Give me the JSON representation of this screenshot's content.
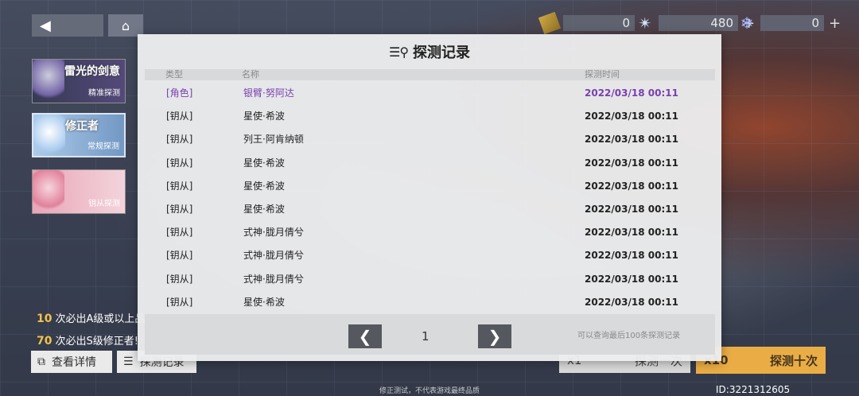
{
  "top_bar": {
    "currencies": [
      {
        "icon": "ticket-icon",
        "value": "0"
      },
      {
        "icon": "star-crystal-icon",
        "value": "480"
      },
      {
        "icon": "snowflake-icon",
        "value": "0"
      }
    ],
    "plus_symbol": "+"
  },
  "banners": [
    {
      "title": "雷光的剑意",
      "subtitle": "精准探测"
    },
    {
      "title": "修正者",
      "subtitle": "常规探测"
    },
    {
      "title": "",
      "subtitle": "钥从探测"
    }
  ],
  "notes": [
    {
      "num": "10",
      "text": "次必出A级或以上品"
    },
    {
      "num": "70",
      "text": "次必出S级修正者!"
    }
  ],
  "bottom_buttons": {
    "details": "查看详情",
    "records": "探测记录"
  },
  "draw": {
    "one_count": "x1",
    "one_label": "探测一次",
    "ten_count": "x10",
    "ten_label": "探测十次"
  },
  "footer_note": "修正测试，不代表游戏最终品质",
  "uid": "ID:3221312605",
  "modal": {
    "title": "探测记录",
    "columns": {
      "type": "类型",
      "name": "名称",
      "time": "探测时间"
    },
    "rows": [
      {
        "type": "[角色]",
        "name": "银臂·努阿达",
        "time": "2022/03/18 00:11",
        "rare": true
      },
      {
        "type": "[钥从]",
        "name": "星使·希波",
        "time": "2022/03/18 00:11",
        "rare": false
      },
      {
        "type": "[钥从]",
        "name": "列王·阿肯纳顿",
        "time": "2022/03/18 00:11",
        "rare": false
      },
      {
        "type": "[钥从]",
        "name": "星使·希波",
        "time": "2022/03/18 00:11",
        "rare": false
      },
      {
        "type": "[钥从]",
        "name": "星使·希波",
        "time": "2022/03/18 00:11",
        "rare": false
      },
      {
        "type": "[钥从]",
        "name": "星使·希波",
        "time": "2022/03/18 00:11",
        "rare": false
      },
      {
        "type": "[钥从]",
        "name": "式神·胧月倩兮",
        "time": "2022/03/18 00:11",
        "rare": false
      },
      {
        "type": "[钥从]",
        "name": "式神·胧月倩兮",
        "time": "2022/03/18 00:11",
        "rare": false
      },
      {
        "type": "[钥从]",
        "name": "式神·胧月倩兮",
        "time": "2022/03/18 00:11",
        "rare": false
      },
      {
        "type": "[钥从]",
        "name": "星使·希波",
        "time": "2022/03/18 00:11",
        "rare": false
      }
    ],
    "pager": {
      "prev": "❮",
      "page": "1",
      "next": "❯",
      "note": "可以查询最后100条探测记录"
    },
    "colors": {
      "rare": "#7a3fb0",
      "accent": "#e9a83a"
    }
  }
}
